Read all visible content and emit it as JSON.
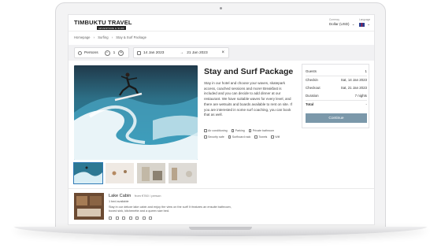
{
  "header": {
    "logo": "TIMBUKTU TRAVEL",
    "logo_sub": "ADVENTURE & SURF",
    "currency_label": "Currency",
    "currency_value": "Dollar (USD)",
    "language_label": "Language"
  },
  "breadcrumb": [
    "Homepage",
    "Surfing",
    "Stay & Surf Package"
  ],
  "search": {
    "persons_label": "Persons",
    "persons_value": "1",
    "checkin": "14 Jan 2023",
    "checkout": "21 Jan 2023"
  },
  "listing": {
    "title": "Stay and Surf Package",
    "description": "Stay in our hotel and choose your waves, skatepark access, coached sessions and more! Breakfast is included and you can decide to add dinner at our restaurant. We have suitable waves for every level, and there are wetsuits and boards available to rent on site. If you are interested in some surf coaching, you can book that as well.",
    "amenities": [
      [
        "Air conditioning",
        "Parking",
        "Private bathroom"
      ],
      [
        "Security safe",
        "Surfboard rack",
        "Towels",
        "Wifi"
      ]
    ]
  },
  "booking": {
    "rows": [
      {
        "label": "Guests",
        "value": "1"
      },
      {
        "label": "Checkin",
        "value": "Sat, 14 Jan 2023"
      },
      {
        "label": "Checkout",
        "value": "Sat, 21 Jan 2023"
      },
      {
        "label": "Duration",
        "value": "7 nights"
      },
      {
        "label": "Total",
        "value": "-"
      }
    ],
    "continue_label": "Continue"
  },
  "room": {
    "name": "Lake Cabin",
    "price": "from €760 / person",
    "availability": "1 bed available",
    "description": "Stay in our deluxe lake cabin and enjoy the view on the surf! It features an ensuite bathroom, boxed sink, kitchenette and a queen size bed."
  },
  "colors": {
    "accent": "#7b98aa",
    "thumb_active": "#2f7ab5"
  }
}
